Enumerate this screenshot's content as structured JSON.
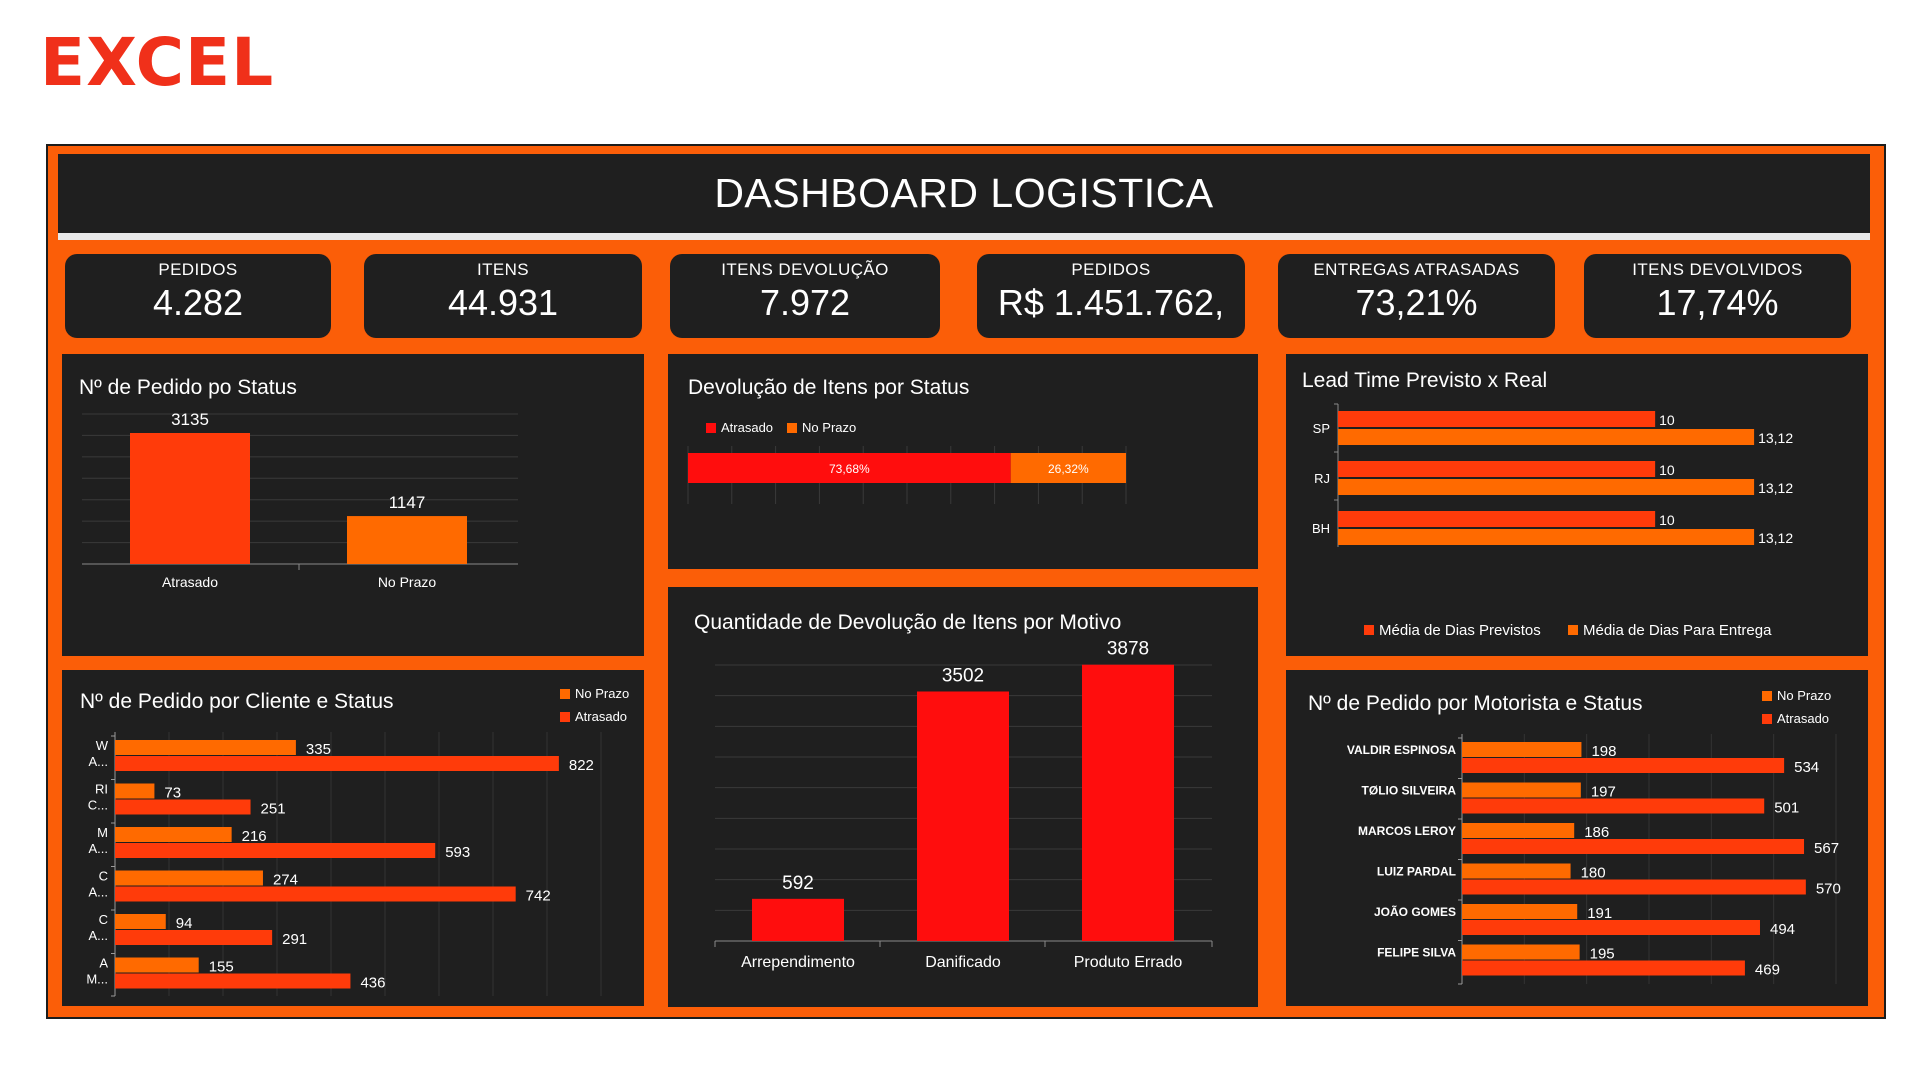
{
  "brand": "EXCEL",
  "title": "DASHBOARD LOGISTICA",
  "kpis": [
    {
      "label": "PEDIDOS",
      "value": "4.282"
    },
    {
      "label": "ITENS",
      "value": "44.931"
    },
    {
      "label": "ITENS DEVOLUÇÃO",
      "value": "7.972"
    },
    {
      "label": "PEDIDOS",
      "value": "R$  1.451.762,"
    },
    {
      "label": "ENTREGAS ATRASADAS",
      "value": "73,21%"
    },
    {
      "label": "ITENS DEVOLVIDOS",
      "value": "17,74%"
    }
  ],
  "colors": {
    "red": "#ff0d0d",
    "red_orange": "#ff3b0a",
    "orange": "#ff6a00",
    "panel": "#1f1f1f",
    "frame": "#fb5e08"
  },
  "chart_data": [
    {
      "type": "bar",
      "title": "Nº de Pedido po Status",
      "categories": [
        "Atrasado",
        "No Prazo"
      ],
      "values": [
        3135,
        1147
      ],
      "ylim": [
        0,
        3500
      ],
      "grid": true
    },
    {
      "type": "bar",
      "orientation": "horizontal-stacked-100",
      "title": "Devolução de Itens por Status",
      "series": [
        {
          "name": "Atrasado",
          "value": 73.68,
          "label": "73,68%"
        },
        {
          "name": "No Prazo",
          "value": 26.32,
          "label": "26,32%"
        }
      ],
      "legend": "top-left",
      "grid": true
    },
    {
      "type": "bar",
      "orientation": "horizontal",
      "title": "Lead Time Previsto x Real",
      "categories": [
        "SP",
        "RJ",
        "BH"
      ],
      "series": [
        {
          "name": "Média de Dias Previstos",
          "values": [
            10,
            10,
            10
          ],
          "labels": [
            "10",
            "10",
            "10"
          ]
        },
        {
          "name": "Média de Dias Para Entrega",
          "values": [
            13.12,
            13.12,
            13.12
          ],
          "labels": [
            "13,12",
            "13,12",
            "13,12"
          ]
        }
      ],
      "xlim": [
        0,
        14
      ],
      "legend": "bottom"
    },
    {
      "type": "bar",
      "title": "Quantidade de Devolução de Itens por Motivo",
      "categories": [
        "Arrependimento",
        "Danificado",
        "Produto Errado"
      ],
      "values": [
        592,
        3502,
        3878
      ],
      "ylim": [
        0,
        4000
      ],
      "grid": true
    },
    {
      "type": "bar",
      "orientation": "horizontal",
      "title": "Nº de Pedido por Cliente e Status",
      "categories": [
        [
          "W",
          "A..."
        ],
        [
          "RI",
          "C..."
        ],
        [
          "M",
          "A..."
        ],
        [
          "C",
          "A..."
        ],
        [
          "C",
          "A..."
        ],
        [
          "A",
          "M..."
        ]
      ],
      "series": [
        {
          "name": "No Prazo",
          "values": [
            335,
            73,
            216,
            274,
            94,
            155
          ]
        },
        {
          "name": "Atrasado",
          "values": [
            822,
            251,
            593,
            742,
            291,
            436
          ]
        }
      ],
      "xlim": [
        0,
        900
      ],
      "legend": "top-right",
      "grid": true
    },
    {
      "type": "bar",
      "orientation": "horizontal",
      "title": "Nº de Pedido por Motorista e Status",
      "categories": [
        "VALDIR ESPINOSA",
        "TØLIO SILVEIRA",
        "MARCOS LEROY",
        "LUIZ PARDAL",
        "JOÃO GOMES",
        "FELIPE SILVA"
      ],
      "series": [
        {
          "name": "No Prazo",
          "values": [
            198,
            197,
            186,
            180,
            191,
            195
          ]
        },
        {
          "name": "Atrasado",
          "values": [
            534,
            501,
            567,
            570,
            494,
            469
          ]
        }
      ],
      "xlim": [
        0,
        620
      ],
      "legend": "top-right",
      "grid": true
    }
  ]
}
